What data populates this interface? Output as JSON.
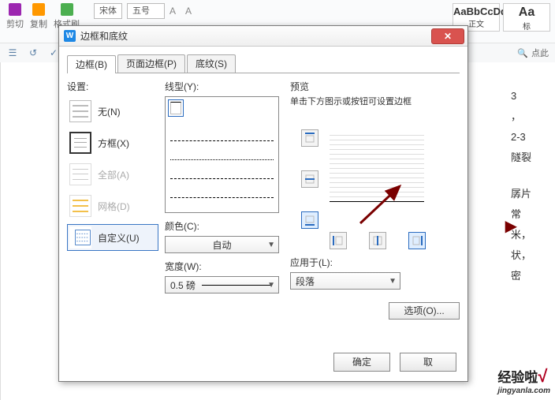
{
  "ribbon": {
    "cut": "剪切",
    "copy": "复制",
    "fmtpainter": "格式刷",
    "font_family": "宋体",
    "font_size": "五号",
    "style1_preview": "AaBbCcDd",
    "style1_label": "正文",
    "style2_preview": "Aa",
    "style2_label": "标",
    "search_placeholder": "点此"
  },
  "doc": {
    "l1": "3",
    "l2": "，",
    "l3": "2-3",
    "l4": "隧裂",
    "l5": "",
    "l6": "孱片",
    "l7": "常",
    "l8": "米，",
    "l9": "状，",
    "l10": "密"
  },
  "dialog": {
    "title": "边框和底纹",
    "tabs": {
      "border": "边框(B)",
      "page_border": "页面边框(P)",
      "shading": "底纹(S)"
    },
    "settings": {
      "header": "设置:",
      "none": "无(N)",
      "box": "方框(X)",
      "all": "全部(A)",
      "grid": "网格(D)",
      "custom": "自定义(U)"
    },
    "line": {
      "label": "线型(Y):",
      "color_label": "颜色(C):",
      "color_value": "自动",
      "width_label": "宽度(W):",
      "width_value": "0.5 磅"
    },
    "preview": {
      "header": "预览",
      "hint": "单击下方图示或按钮可设置边框",
      "apply_to_label": "应用于(L):",
      "apply_to_value": "段落",
      "options": "选项(O)..."
    },
    "ok": "确定",
    "cancel": "取"
  },
  "watermark": {
    "main": "经验啦",
    "sub": "jingyanla.com"
  }
}
